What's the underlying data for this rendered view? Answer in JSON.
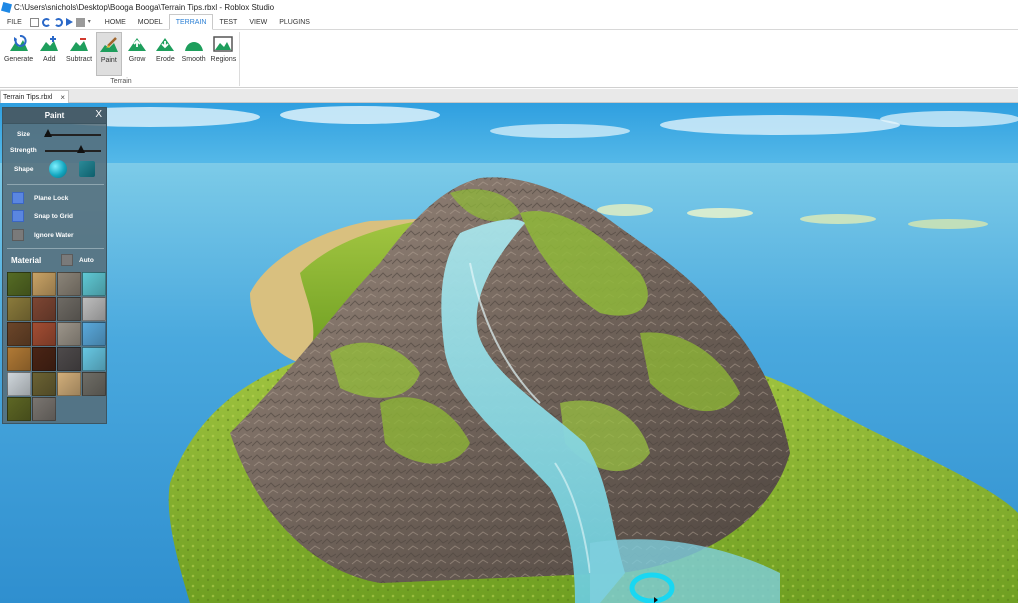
{
  "window": {
    "title": "C:\\Users\\snichols\\Desktop\\Booga Booga\\Terrain Tips.rbxl - Roblox Studio",
    "icon": "roblox-studio-icon"
  },
  "menu": {
    "file": "FILE",
    "tabs": [
      "HOME",
      "MODEL",
      "TERRAIN",
      "TEST",
      "VIEW",
      "PLUGINS"
    ],
    "active_tab": "TERRAIN"
  },
  "ribbon": {
    "group_label": "Terrain",
    "tools": [
      {
        "label": "Generate",
        "icon": "terrain-generate-icon"
      },
      {
        "label": "Add",
        "icon": "terrain-add-icon"
      },
      {
        "label": "Subtract",
        "icon": "terrain-subtract-icon"
      },
      {
        "label": "Paint",
        "icon": "terrain-paint-icon",
        "selected": true
      },
      {
        "label": "Grow",
        "icon": "terrain-grow-icon"
      },
      {
        "label": "Erode",
        "icon": "terrain-erode-icon"
      },
      {
        "label": "Smooth",
        "icon": "terrain-smooth-icon"
      },
      {
        "label": "Regions",
        "icon": "terrain-regions-icon"
      }
    ]
  },
  "document_tab": {
    "name": "Terrain Tips.rbxl",
    "close": "×"
  },
  "paint_panel": {
    "title": "Paint",
    "close": "X",
    "size_label": "Size",
    "size_level": 0.05,
    "strength_label": "Strength",
    "strength_level": 0.65,
    "shape_label": "Shape",
    "shapes": [
      "sphere",
      "cube"
    ],
    "selected_shape": "sphere",
    "options": [
      {
        "label": "Plane Lock",
        "checked": true
      },
      {
        "label": "Snap to Grid",
        "checked": true
      },
      {
        "label": "Ignore Water",
        "checked": false
      }
    ],
    "material_label": "Material",
    "auto_label": "Auto",
    "auto_checked": false,
    "materials": [
      {
        "name": "grass",
        "color": "#556b24"
      },
      {
        "name": "sand",
        "color": "#c8a265"
      },
      {
        "name": "rock",
        "color": "#8b8478"
      },
      {
        "name": "water",
        "color": "#5fc8d4"
      },
      {
        "name": "ground",
        "color": "#8a7a3b"
      },
      {
        "name": "brick",
        "color": "#7d4633"
      },
      {
        "name": "slate",
        "color": "#6e6a64"
      },
      {
        "name": "concrete",
        "color": "#bdbdbd"
      },
      {
        "name": "wood-planks",
        "color": "#6b4529"
      },
      {
        "name": "red-brick",
        "color": "#a24d33"
      },
      {
        "name": "limestone",
        "color": "#9c958a"
      },
      {
        "name": "ice",
        "color": "#5aa9dc"
      },
      {
        "name": "wood",
        "color": "#b07935"
      },
      {
        "name": "crackedlava",
        "color": "#4a2415"
      },
      {
        "name": "basalt",
        "color": "#4e4a4b"
      },
      {
        "name": "glacier",
        "color": "#67c7e3"
      },
      {
        "name": "snow",
        "color": "#cfd6db"
      },
      {
        "name": "mud",
        "color": "#6b6233"
      },
      {
        "name": "sandstone",
        "color": "#d1ae7a"
      },
      {
        "name": "pavement",
        "color": "#6f6d66"
      },
      {
        "name": "leafy-grass",
        "color": "#5d6624"
      },
      {
        "name": "cobblestone",
        "color": "#7a7570"
      }
    ]
  },
  "colors": {
    "active_tab": "#2a7fd4",
    "sky": "#4fb5e6",
    "water": "#3f9fd8",
    "grass": "#7cab2c",
    "rock": "#7e7063",
    "brush_ring": "#19d7f2"
  }
}
